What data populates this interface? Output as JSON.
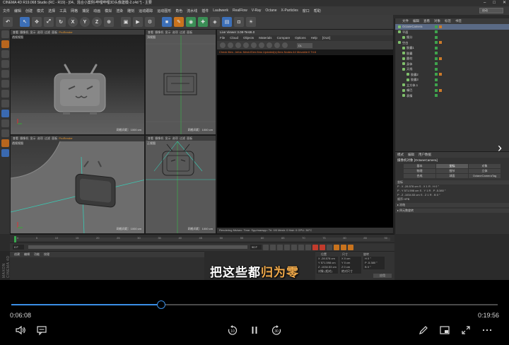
{
  "app": {
    "title": "CINEMA 4D R19.068 Studio (RC - R19) - [04、混合小案例-哔哩哔哩3D头像建模-2.c4d *] - 主要",
    "menu": [
      "文件",
      "编辑",
      "创建",
      "模式",
      "选择",
      "工具",
      "网格",
      "捕捉",
      "动画",
      "模拟",
      "渲染",
      "雕刻",
      "运动跟踪",
      "运动图形",
      "角色",
      "流水线",
      "插件",
      "Laubwerk",
      "RealFlow",
      "V-Ray",
      "Octane",
      "X-Particles",
      "窗口",
      "帮助"
    ],
    "layout_label": "启动"
  },
  "viewports": {
    "menu": [
      "查看",
      "摄像机",
      "显示",
      "选项",
      "过滤",
      "面板"
    ],
    "pro_render": "ProRender",
    "top_left": {
      "label": "透视视图",
      "scale": "网格间距：1000 cm"
    },
    "top_right": {
      "label": "顶视图",
      "scale": "网格间距：1000 cm"
    },
    "bottom_left": {
      "label": "透视视图",
      "scale": "网格间距：1000 cm"
    },
    "bottom_right": {
      "label": "正视图",
      "scale": "网格间距：1000 cm"
    }
  },
  "live_viewer": {
    "title": "Live Viewer 3.08-Test6.0",
    "menu": [
      "File",
      "Cloud",
      "Objects",
      "Materials",
      "Compare",
      "Options",
      "Help",
      "[OLE]"
    ],
    "combo": "DL",
    "status": "Check files...Infos: Mesh/Gen:8ms  Updated(s):5ms  Nodes:44  Movable:0  Tri:6",
    "bottom": "Rendering   Ms/sec:   Time:   Spp/maxspp:   Tri: 0/0   Mesh: 0   Hair: 0   GPU:   36°C"
  },
  "object_manager": {
    "menu": [
      "文件",
      "编辑",
      "查看",
      "对象",
      "标签",
      "书签"
    ],
    "rows": [
      {
        "name": "OctaneCamera",
        "indent": 0,
        "selected": true
      },
      {
        "name": "平面",
        "indent": 0,
        "selected": false
      },
      {
        "name": "细分",
        "indent": 1,
        "selected": false
      },
      {
        "name": "空白",
        "indent": 0,
        "selected": false
      },
      {
        "name": "胶囊1",
        "indent": 1,
        "selected": false
      },
      {
        "name": "胶囊",
        "indent": 1,
        "selected": false
      },
      {
        "name": "圆柱",
        "indent": 1,
        "selected": false
      },
      {
        "name": "身体",
        "indent": 1,
        "selected": false
      },
      {
        "name": "天线",
        "indent": 1,
        "selected": false
      },
      {
        "name": "胶囊2",
        "indent": 2,
        "selected": false
      },
      {
        "name": "胶囊3",
        "indent": 2,
        "selected": false
      },
      {
        "name": "立方体.1",
        "indent": 1,
        "selected": false
      },
      {
        "name": "嘴巴",
        "indent": 1,
        "selected": false
      },
      {
        "name": "表情",
        "indent": 1,
        "selected": false
      }
    ]
  },
  "attribute_manager": {
    "menu": [
      "模式",
      "编辑",
      "用户数据"
    ],
    "object": "摄像机对象 [OctaneCamera]",
    "tabs": [
      "基本",
      "坐标",
      "对象",
      "物理",
      "细节",
      "立体",
      "合成",
      "球面",
      "OctaneCameraTag"
    ],
    "active_tab": 1,
    "section": "坐标",
    "fields": [
      "P . X  -28.578 cm   S . X  1   R . H  0 °",
      "P . Y  571.598 cm   S . Y  1   R . P  -5.380 °",
      "P . Z  -1034.53 cm   S . Z  1   R . B  0 °"
    ],
    "order": "顺序  HPB",
    "collapsed": [
      "▸ 冻结",
      "▸ 四元数旋转"
    ]
  },
  "timeline": {
    "ticks": [
      "0",
      "5",
      "10",
      "15",
      "20",
      "25",
      "30",
      "35",
      "40",
      "45",
      "50",
      "55",
      "60",
      "65",
      "70",
      "75",
      "80",
      "85",
      "90"
    ],
    "current": "0 F",
    "end": "90 F"
  },
  "material": {
    "menu": [
      "创建",
      "编辑",
      "功能",
      "纹理"
    ]
  },
  "coordinates": {
    "headers": [
      "位置",
      "尺寸",
      "旋转"
    ],
    "rows": [
      [
        "X -28.578 cm",
        "X 0 cm",
        "H 0 °"
      ],
      [
        "Y 571.598 cm",
        "Y 0 cm",
        "P -5.380 °"
      ],
      [
        "Z -1034.53 cm",
        "Z 0 cm",
        "B 0 °"
      ]
    ],
    "mode": "对象 (相对)",
    "size_mode": "绝对尺寸",
    "apply": "应用"
  },
  "branding": "MAXON CINEMA 4D",
  "subtitle": {
    "before": "把这些都",
    "highlight": "归为零"
  },
  "player": {
    "current_time": "0:06:08",
    "total_time": "0:19:56",
    "progress": 0.3077
  },
  "colors": {
    "accent": "#3a8ee6",
    "highlight": "#f0a94a",
    "c4d_orange": "#c9731d"
  }
}
